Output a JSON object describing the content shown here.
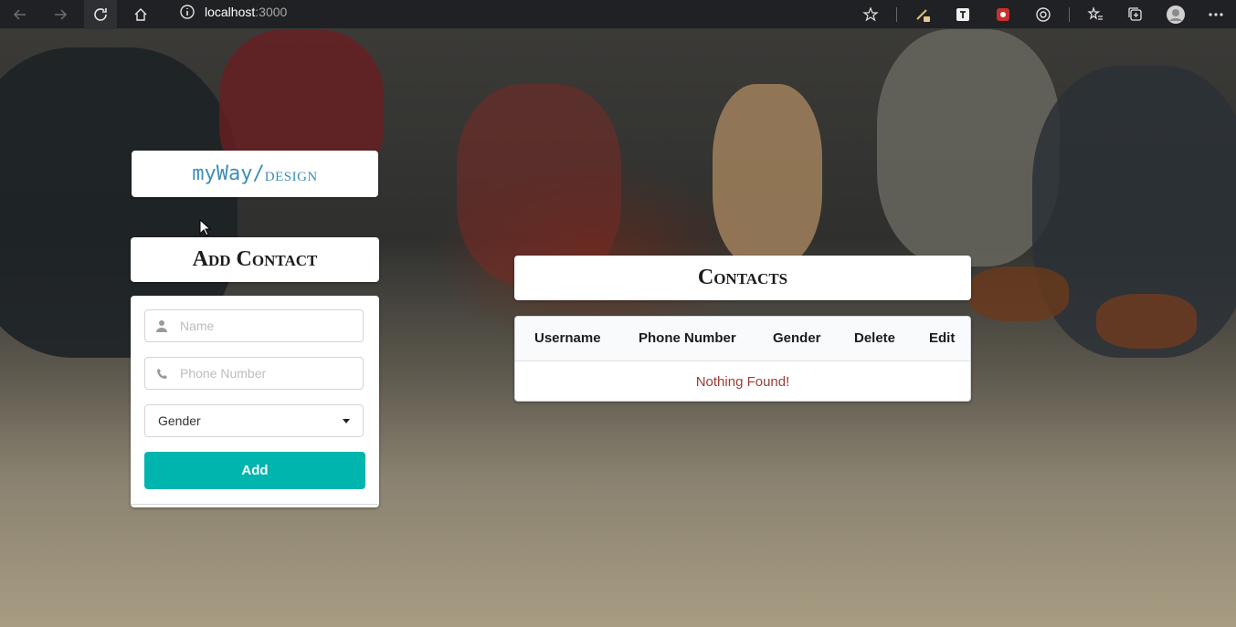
{
  "browser": {
    "url_host": "localhost",
    "url_port": ":3000"
  },
  "logo": {
    "main": "myWay/",
    "sub": "design"
  },
  "add_contact": {
    "title": "Add Contact",
    "name_placeholder": "Name",
    "phone_placeholder": "Phone Number",
    "gender_value": "Gender",
    "add_label": "Add"
  },
  "contacts": {
    "title": "Contacts",
    "columns": [
      "Username",
      "Phone Number",
      "Gender",
      "Delete",
      "Edit"
    ],
    "empty_message": "Nothing Found!"
  },
  "colors": {
    "accent": "#00b5ad",
    "logo": "#3d8eb9",
    "error_text": "#9f3a38"
  }
}
